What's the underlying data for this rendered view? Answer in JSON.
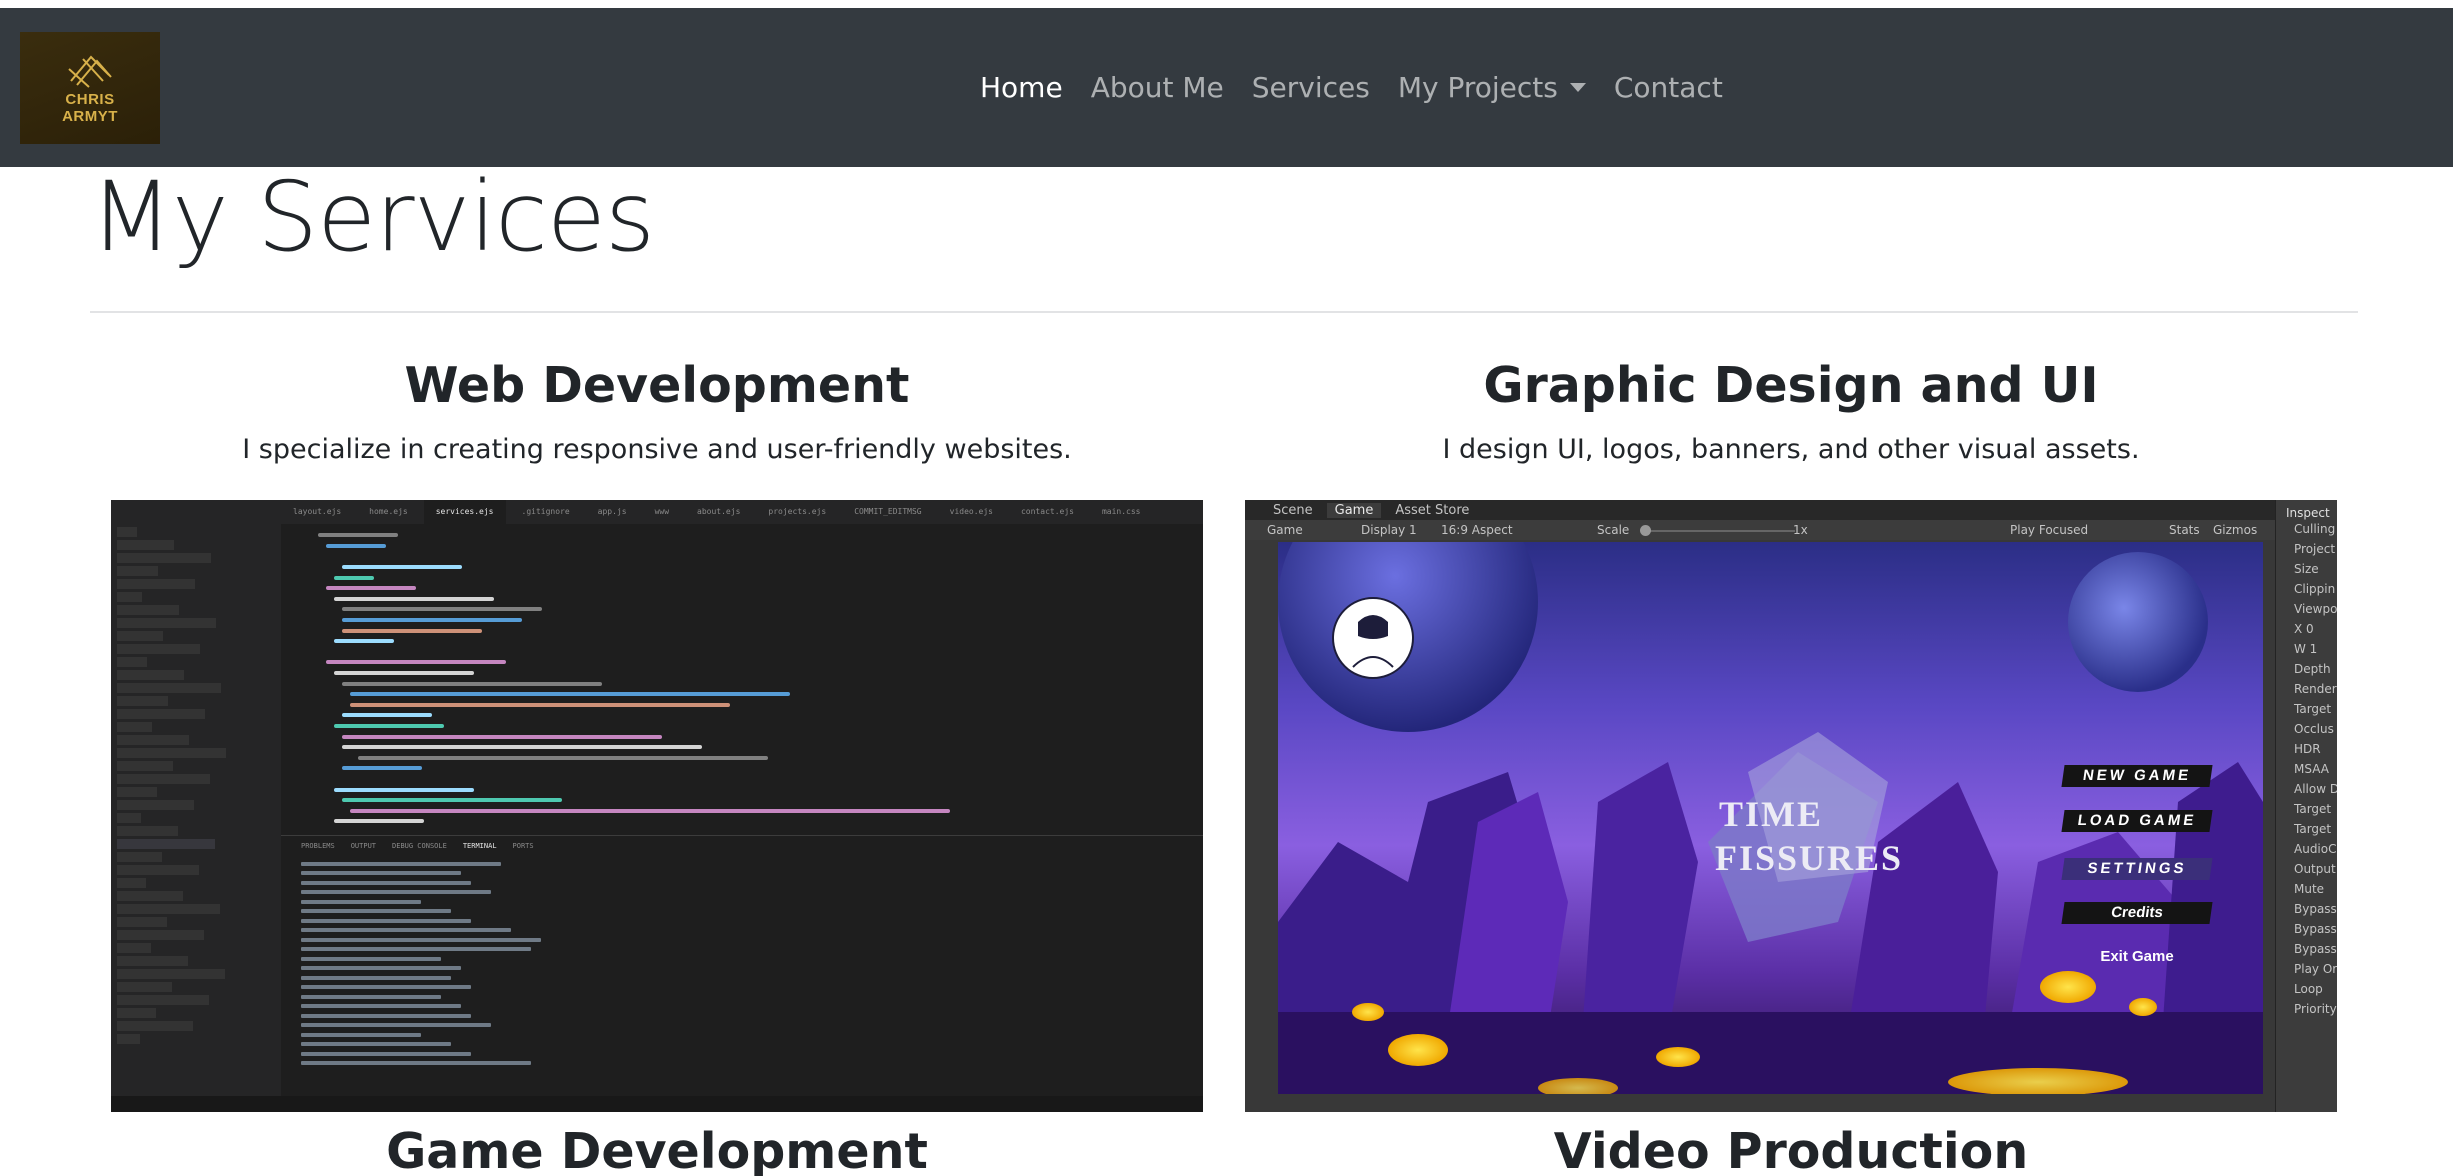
{
  "brand": {
    "line1": "CHRIS",
    "line2": "ARMYT"
  },
  "nav": {
    "items": [
      {
        "label": "Home",
        "active": true
      },
      {
        "label": "About Me",
        "active": false
      },
      {
        "label": "Services",
        "active": false
      },
      {
        "label": "My Projects",
        "active": false,
        "dropdown": true
      },
      {
        "label": "Contact",
        "active": false
      }
    ]
  },
  "page": {
    "title": "My Services"
  },
  "services": [
    {
      "title": "Web Development",
      "description": "I specialize in creating responsive and user-friendly websites."
    },
    {
      "title": "Graphic Design and UI",
      "description": "I design UI, logos, banners, and other visual assets."
    },
    {
      "title": "Game Development"
    },
    {
      "title": "Video Production"
    }
  ],
  "vscode": {
    "tabs": [
      "layout.ejs",
      "home.ejs",
      "services.ejs",
      ".gitignore",
      "app.js",
      "www",
      "about.ejs",
      "projects.ejs",
      "COMMIT_EDITMSG",
      "video.ejs",
      "contact.ejs",
      "main.css"
    ],
    "panel_tabs": [
      "PROBLEMS",
      "OUTPUT",
      "DEBUG CONSOLE",
      "TERMINAL",
      "PORTS"
    ]
  },
  "unity": {
    "tabs": [
      "Scene",
      "Game",
      "Asset Store"
    ],
    "toolbar": {
      "view": "Game",
      "display": "Display 1",
      "aspect": "16:9 Aspect",
      "scale_label": "Scale",
      "scale_value": "1x",
      "play_mode": "Play Focused",
      "stats": "Stats",
      "gizmos": "Gizmos"
    },
    "inspector_title": "Inspect",
    "inspector_labels": [
      "Culling",
      "Project",
      "Size",
      "Clippin",
      "Viewpo",
      "X 0",
      "W 1",
      "Depth",
      "Render",
      "Target",
      "Occlus",
      "HDR",
      "MSAA",
      "Allow D",
      "Target",
      "Target",
      "AudioC",
      "Output",
      "Mute",
      "Bypass",
      "Bypass",
      "Bypass",
      "Play Or",
      "Loop",
      "Priority"
    ],
    "game_menu": [
      "NEW GAME",
      "LOAD GAME",
      "SETTINGS",
      "Credits",
      "Exit Game"
    ],
    "game_logo": [
      "TIME",
      "FISSURES"
    ]
  },
  "colors": {
    "navbar": "#343a40",
    "brand_bg": "#2f240b",
    "brand_gold": "#d8b14a"
  }
}
